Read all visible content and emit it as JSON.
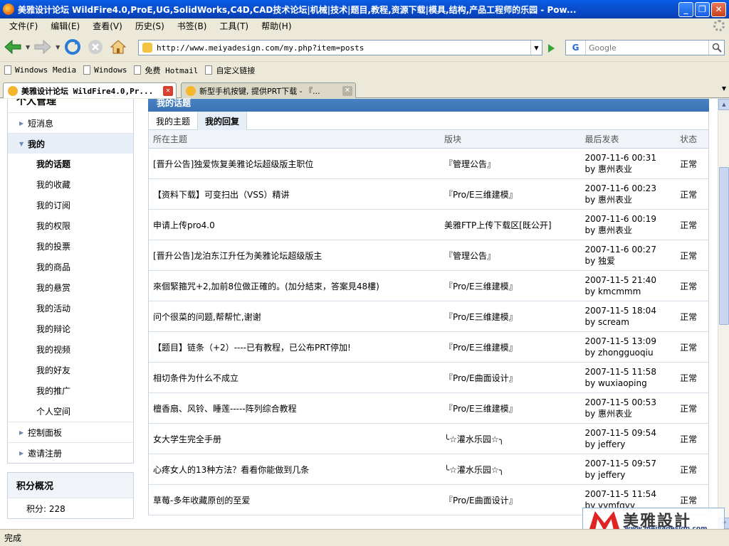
{
  "window": {
    "title": "美雅设计论坛 WildFire4.0,ProE,UG,SolidWorks,C4D,CAD技术论坛|机械|技术|题目,教程,资源下载|模具,结构,产品工程师的乐园 - Pow..."
  },
  "menu": [
    "文件(F)",
    "编辑(E)",
    "查看(V)",
    "历史(S)",
    "书签(B)",
    "工具(T)",
    "帮助(H)"
  ],
  "address": {
    "url": "http://www.meiyadesign.com/my.php?item=posts"
  },
  "search": {
    "placeholder": "Google",
    "engine": "G"
  },
  "bookmarks": [
    "Windows Media",
    "Windows",
    "免费 Hotmail",
    "自定义链接"
  ],
  "tabs": [
    {
      "label": "美雅设计论坛 WildFire4.0,Pr..."
    },
    {
      "label": "新型手机按键, 提供PRT下载 - 『..."
    }
  ],
  "sidebar": {
    "title": "个人管理",
    "items": [
      {
        "label": "短消息"
      },
      {
        "label": "我的"
      }
    ],
    "sub_items": [
      "我的话题",
      "我的收藏",
      "我的订阅",
      "我的权限",
      "我的投票",
      "我的商品",
      "我的悬赏",
      "我的活动",
      "我的辩论",
      "我的视频",
      "我的好友",
      "我的推广",
      "个人空间"
    ],
    "more_items": [
      {
        "label": "控制面板"
      },
      {
        "label": "邀请注册"
      }
    ],
    "credits_title": "积分概况",
    "credits": [
      "积分: 228"
    ]
  },
  "main": {
    "panel_title": "我的话题",
    "tabs": [
      "我的主题",
      "我的回复"
    ],
    "columns": [
      "所在主题",
      "版块",
      "最后发表",
      "状态"
    ],
    "rows": [
      {
        "topic": "[晋升公告]独爱恢复美雅论坛超级版主职位",
        "forum": "『管理公告』",
        "time": "2007-11-6 00:31",
        "by": "by 惠州表业",
        "status": "正常"
      },
      {
        "topic": "【资料下载】可变扫出（VSS）精讲",
        "forum": "『Pro/E三维建模』",
        "time": "2007-11-6 00:23",
        "by": "by 惠州表业",
        "status": "正常"
      },
      {
        "topic": "申请上传pro4.0",
        "forum": "美雅FTP上传下载区[既公开]",
        "time": "2007-11-6 00:19",
        "by": "by 惠州表业",
        "status": "正常"
      },
      {
        "topic": "[晋升公告]龙泊东江升任为美雅论坛超级版主",
        "forum": "『管理公告』",
        "time": "2007-11-6 00:27",
        "by": "by 独爱",
        "status": "正常"
      },
      {
        "topic": "來個緊箍咒+2,加前8位做正確的。(加分結束，答案見48樓)",
        "forum": "『Pro/E三维建模』",
        "time": "2007-11-5 21:40",
        "by": "by kmcmmm",
        "status": "正常"
      },
      {
        "topic": "问个很菜的问题,帮帮忙,谢谢",
        "forum": "『Pro/E三维建模』",
        "time": "2007-11-5 18:04",
        "by": "by scream",
        "status": "正常"
      },
      {
        "topic": "【题目】链条（+2）----已有教程，已公布PRT停加!",
        "forum": "『Pro/E三维建模』",
        "time": "2007-11-5 13:09",
        "by": "by zhongguoqiu",
        "status": "正常"
      },
      {
        "topic": "相切条件为什么不成立",
        "forum": "『Pro/E曲面设计』",
        "time": "2007-11-5 11:58",
        "by": "by wuxiaoping",
        "status": "正常"
      },
      {
        "topic": "檀香扇、风铃、睡莲-----阵列综合教程",
        "forum": "『Pro/E三维建模』",
        "time": "2007-11-5 00:53",
        "by": "by 惠州表业",
        "status": "正常"
      },
      {
        "topic": "女大学生完全手册",
        "forum": "╰☆灌水乐园☆╮",
        "time": "2007-11-5 09:54",
        "by": "by jeffery",
        "status": "正常"
      },
      {
        "topic": "心疼女人的13种方法？看看你能做到几条",
        "forum": "╰☆灌水乐园☆╮",
        "time": "2007-11-5 09:57",
        "by": "by jeffery",
        "status": "正常"
      },
      {
        "topic": "草莓-多年收藏原创的至爱",
        "forum": "『Pro/E曲面设计』",
        "time": "2007-11-5 11:54",
        "by": "by yymfqyy",
        "status": "正常"
      }
    ]
  },
  "watermark": {
    "text": "美雅設計",
    "url": "www.meiyadesign.com"
  },
  "status": {
    "text": "完成"
  }
}
